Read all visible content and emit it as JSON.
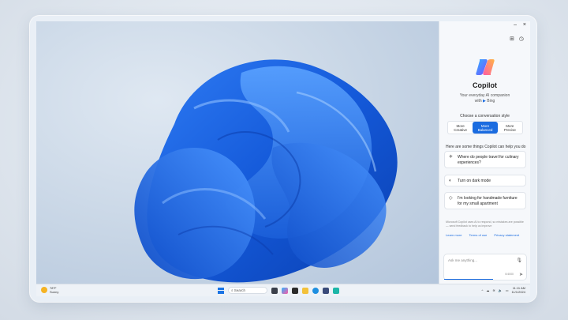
{
  "window_controls": {
    "minimize": "–",
    "close": "×"
  },
  "copilot": {
    "title": "Copilot",
    "tagline_line1": "Your everyday AI companion",
    "tagline_line2": "with",
    "tagline_brand": "Bing",
    "style_label": "Choose a conversation style",
    "styles": [
      {
        "line1": "More",
        "line2": "Creative"
      },
      {
        "line1": "More",
        "line2": "Balanced"
      },
      {
        "line1": "More",
        "line2": "Precise"
      }
    ],
    "active_style_index": 1,
    "help_heading": "Here are some things Copilot can help you do",
    "suggestions": [
      {
        "icon": "plane-icon",
        "text": "Where do people travel for culinary experiences?"
      },
      {
        "icon": "theme-icon",
        "text": "Turn on dark mode"
      },
      {
        "icon": "tag-icon",
        "text": "I'm looking for handmade furniture for my small apartment"
      }
    ],
    "disclaimer": "Microsoft Copilot uses AI to respond, so mistakes are possible — send feedback to help us improve",
    "links": [
      "Learn more",
      "Terms of use",
      "Privacy statement"
    ],
    "ask_placeholder": "Ask me anything...",
    "char_count": "0/4000"
  },
  "taskbar": {
    "weather_temp": "78°F",
    "weather_desc": "Sunny",
    "search_label": "Search",
    "clock_time": "11:11 AM",
    "clock_date": "11/1/2024"
  },
  "colors": {
    "accent": "#1b6ce0",
    "windows_blue": "#1b74e4",
    "sun": "#f5b324"
  }
}
